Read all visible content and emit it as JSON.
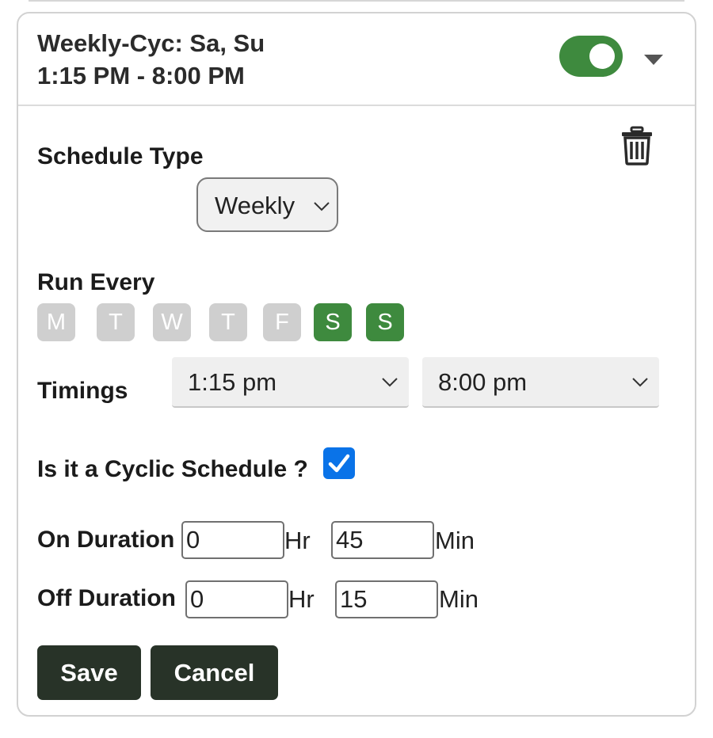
{
  "header": {
    "title": "Weekly-Cyc: Sa, Su",
    "time_range": "1:15 PM - 8:00 PM",
    "enabled": true,
    "expand_icon": "caret-down-icon"
  },
  "delete_icon": "trash-icon",
  "schedule_type": {
    "label": "Schedule Type",
    "selected": "Weekly"
  },
  "run_every": {
    "label": "Run Every",
    "days": [
      {
        "letter": "M",
        "selected": false
      },
      {
        "letter": "T",
        "selected": false
      },
      {
        "letter": "W",
        "selected": false
      },
      {
        "letter": "T",
        "selected": false
      },
      {
        "letter": "F",
        "selected": false
      },
      {
        "letter": "S",
        "selected": true
      },
      {
        "letter": "S",
        "selected": true
      }
    ]
  },
  "timings": {
    "label": "Timings",
    "start": "1:15 pm",
    "end": "8:00 pm"
  },
  "cyclic": {
    "label": "Is it a Cyclic Schedule ?",
    "checked": true
  },
  "on_duration": {
    "label": "On Duration",
    "hours": "0",
    "hours_unit": "Hr",
    "minutes": "45",
    "minutes_unit": "Min"
  },
  "off_duration": {
    "label": "Off Duration",
    "hours": "0",
    "hours_unit": "Hr",
    "minutes": "15",
    "minutes_unit": "Min"
  },
  "buttons": {
    "save": "Save",
    "cancel": "Cancel"
  },
  "colors": {
    "accent_green": "#3e8a3e",
    "day_inactive": "#cfcfcf",
    "checkbox_blue": "#0a73e8",
    "button_dark": "#283328"
  }
}
